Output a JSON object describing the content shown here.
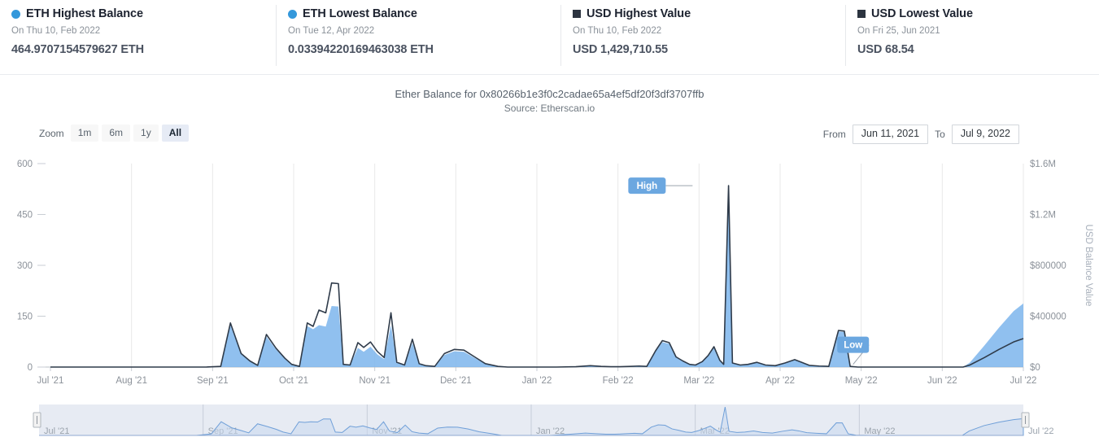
{
  "stats": [
    {
      "marker": "circle-marker-blue",
      "title": "ETH Highest Balance",
      "date": "On Thu 10, Feb 2022",
      "value": "464.9707154579627 ETH"
    },
    {
      "marker": "circle-marker-blue",
      "title": "ETH Lowest Balance",
      "date": "On Tue 12, Apr 2022",
      "value": "0.03394220169463038 ETH"
    },
    {
      "marker": "square-marker-dark",
      "title": "USD Highest Value",
      "date": "On Thu 10, Feb 2022",
      "value": "USD 1,429,710.55"
    },
    {
      "marker": "square-marker-dark",
      "title": "USD Lowest Value",
      "date": "On Fri 25, Jun 2021",
      "value": "USD 68.54"
    }
  ],
  "toolbar": {
    "zoom_label": "Zoom",
    "zoom_options": [
      "1m",
      "6m",
      "1y",
      "All"
    ],
    "zoom_selected": "All",
    "from_label": "From",
    "to_label": "To",
    "from_value": "Jun 11, 2021",
    "to_value": "Jul 9, 2022"
  },
  "colors": {
    "eth_line": "#2f3b4a",
    "usd_area": "#7cb5ec",
    "usd_area_stroke": "#6ba7e0",
    "flag": "#6ba7e0",
    "grid": "#e8e8e8",
    "axis_text": "#8b9199"
  },
  "chart_data": {
    "type": "area",
    "title": "Ether Balance for 0x80266b1e3f0c2cadae65a4ef5df20f3df3707ffb",
    "subtitle": "Source: Etherscan.io",
    "xlabel": "",
    "ylabel": "",
    "y2label": "USD Balance Value",
    "grid": true,
    "legend_position": "none",
    "x_range": [
      "Jun 11, 2021",
      "Jul 9, 2022"
    ],
    "x_ticks": [
      "Jul '21",
      "Aug '21",
      "Sep '21",
      "Oct '21",
      "Nov '21",
      "Dec '21",
      "Jan '22",
      "Feb '22",
      "Mar '22",
      "Apr '22",
      "May '22",
      "Jun '22",
      "Jul '22"
    ],
    "y_ticks": [
      0,
      150,
      300,
      450,
      600
    ],
    "ylim": [
      0,
      600
    ],
    "y2_ticks": [
      "$0",
      "$400000",
      "$800000",
      "$1.2M",
      "$1.6M"
    ],
    "y2_tick_values": [
      0,
      400000,
      800000,
      1200000,
      1600000
    ],
    "y2lim": [
      0,
      1600000
    ],
    "annotations": [
      {
        "label": "High",
        "at_x": 0.66,
        "at_y": 535
      },
      {
        "label": "Low",
        "at_x": 0.825,
        "at_y": 8
      }
    ],
    "series": [
      {
        "name": "ETH Balance",
        "type": "line",
        "axis": "left",
        "color": "#2f3b4a",
        "points": [
          [
            0.0,
            0
          ],
          [
            0.03,
            0
          ],
          [
            0.06,
            0
          ],
          [
            0.09,
            0
          ],
          [
            0.115,
            0
          ],
          [
            0.14,
            0
          ],
          [
            0.16,
            0
          ],
          [
            0.175,
            2
          ],
          [
            0.185,
            130
          ],
          [
            0.196,
            40
          ],
          [
            0.205,
            18
          ],
          [
            0.213,
            5
          ],
          [
            0.222,
            96
          ],
          [
            0.232,
            55
          ],
          [
            0.241,
            26
          ],
          [
            0.248,
            8
          ],
          [
            0.256,
            2
          ],
          [
            0.264,
            130
          ],
          [
            0.27,
            120
          ],
          [
            0.276,
            168
          ],
          [
            0.283,
            160
          ],
          [
            0.289,
            248
          ],
          [
            0.296,
            246
          ],
          [
            0.301,
            8
          ],
          [
            0.308,
            6
          ],
          [
            0.316,
            72
          ],
          [
            0.322,
            58
          ],
          [
            0.329,
            74
          ],
          [
            0.336,
            46
          ],
          [
            0.343,
            28
          ],
          [
            0.35,
            160
          ],
          [
            0.356,
            14
          ],
          [
            0.364,
            6
          ],
          [
            0.372,
            82
          ],
          [
            0.379,
            10
          ],
          [
            0.386,
            4
          ],
          [
            0.395,
            2
          ],
          [
            0.405,
            40
          ],
          [
            0.415,
            52
          ],
          [
            0.425,
            50
          ],
          [
            0.436,
            30
          ],
          [
            0.447,
            10
          ],
          [
            0.46,
            2
          ],
          [
            0.47,
            0
          ],
          [
            0.485,
            0
          ],
          [
            0.5,
            0
          ],
          [
            0.52,
            0
          ],
          [
            0.54,
            1
          ],
          [
            0.555,
            4
          ],
          [
            0.566,
            2
          ],
          [
            0.576,
            1
          ],
          [
            0.585,
            1
          ],
          [
            0.596,
            2
          ],
          [
            0.605,
            3
          ],
          [
            0.613,
            2
          ],
          [
            0.622,
            48
          ],
          [
            0.629,
            78
          ],
          [
            0.636,
            72
          ],
          [
            0.643,
            30
          ],
          [
            0.65,
            18
          ],
          [
            0.657,
            8
          ],
          [
            0.663,
            6
          ],
          [
            0.67,
            16
          ],
          [
            0.676,
            34
          ],
          [
            0.682,
            60
          ],
          [
            0.688,
            20
          ],
          [
            0.692,
            8
          ],
          [
            0.697,
            535
          ],
          [
            0.701,
            12
          ],
          [
            0.709,
            6
          ],
          [
            0.717,
            8
          ],
          [
            0.726,
            14
          ],
          [
            0.735,
            6
          ],
          [
            0.745,
            4
          ],
          [
            0.755,
            12
          ],
          [
            0.765,
            22
          ],
          [
            0.772,
            14
          ],
          [
            0.78,
            5
          ],
          [
            0.79,
            3
          ],
          [
            0.8,
            2
          ],
          [
            0.81,
            108
          ],
          [
            0.816,
            106
          ],
          [
            0.822,
            2
          ],
          [
            0.83,
            0.03
          ],
          [
            0.845,
            0
          ],
          [
            0.865,
            0
          ],
          [
            0.885,
            0
          ],
          [
            0.905,
            0
          ],
          [
            0.925,
            0
          ],
          [
            0.938,
            0
          ],
          [
            0.945,
            6
          ],
          [
            0.96,
            28
          ],
          [
            0.975,
            52
          ],
          [
            0.99,
            74
          ],
          [
            1.0,
            84
          ]
        ]
      },
      {
        "name": "USD Balance Value",
        "type": "area",
        "axis": "right",
        "color": "#7cb5ec",
        "points": [
          [
            0.0,
            0
          ],
          [
            0.03,
            0
          ],
          [
            0.06,
            0
          ],
          [
            0.09,
            0
          ],
          [
            0.115,
            0
          ],
          [
            0.14,
            0
          ],
          [
            0.16,
            0
          ],
          [
            0.175,
            4000
          ],
          [
            0.185,
            330000
          ],
          [
            0.196,
            100000
          ],
          [
            0.205,
            44000
          ],
          [
            0.213,
            12000
          ],
          [
            0.222,
            238000
          ],
          [
            0.232,
            138000
          ],
          [
            0.241,
            66000
          ],
          [
            0.248,
            20000
          ],
          [
            0.256,
            5000
          ],
          [
            0.264,
            322000
          ],
          [
            0.27,
            298000
          ],
          [
            0.276,
            330000
          ],
          [
            0.283,
            318000
          ],
          [
            0.289,
            480000
          ],
          [
            0.296,
            476000
          ],
          [
            0.301,
            20000
          ],
          [
            0.308,
            15000
          ],
          [
            0.316,
            150000
          ],
          [
            0.322,
            120000
          ],
          [
            0.329,
            160000
          ],
          [
            0.336,
            100000
          ],
          [
            0.343,
            62000
          ],
          [
            0.35,
            330000
          ],
          [
            0.356,
            34000
          ],
          [
            0.364,
            14000
          ],
          [
            0.372,
            190000
          ],
          [
            0.379,
            24000
          ],
          [
            0.386,
            10000
          ],
          [
            0.395,
            5000
          ],
          [
            0.405,
            95000
          ],
          [
            0.415,
            124000
          ],
          [
            0.425,
            120000
          ],
          [
            0.436,
            72000
          ],
          [
            0.447,
            24000
          ],
          [
            0.46,
            5000
          ],
          [
            0.47,
            0
          ],
          [
            0.485,
            0
          ],
          [
            0.5,
            0
          ],
          [
            0.52,
            0
          ],
          [
            0.54,
            2500
          ],
          [
            0.555,
            10000
          ],
          [
            0.566,
            5000
          ],
          [
            0.576,
            2500
          ],
          [
            0.585,
            2500
          ],
          [
            0.596,
            5000
          ],
          [
            0.605,
            8000
          ],
          [
            0.613,
            5000
          ],
          [
            0.622,
            122000
          ],
          [
            0.629,
            196000
          ],
          [
            0.636,
            182000
          ],
          [
            0.643,
            76000
          ],
          [
            0.65,
            46000
          ],
          [
            0.657,
            20000
          ],
          [
            0.663,
            15000
          ],
          [
            0.67,
            40000
          ],
          [
            0.676,
            86000
          ],
          [
            0.682,
            152000
          ],
          [
            0.688,
            50000
          ],
          [
            0.692,
            20000
          ],
          [
            0.697,
            1429710
          ],
          [
            0.701,
            30000
          ],
          [
            0.709,
            15000
          ],
          [
            0.717,
            20000
          ],
          [
            0.726,
            36000
          ],
          [
            0.735,
            15000
          ],
          [
            0.745,
            10000
          ],
          [
            0.755,
            30000
          ],
          [
            0.765,
            56000
          ],
          [
            0.772,
            36000
          ],
          [
            0.78,
            13000
          ],
          [
            0.79,
            8000
          ],
          [
            0.8,
            5000
          ],
          [
            0.81,
            280000
          ],
          [
            0.816,
            275000
          ],
          [
            0.822,
            5000
          ],
          [
            0.83,
            69
          ],
          [
            0.845,
            0
          ],
          [
            0.865,
            0
          ],
          [
            0.885,
            0
          ],
          [
            0.905,
            0
          ],
          [
            0.925,
            0
          ],
          [
            0.938,
            0
          ],
          [
            0.945,
            35000
          ],
          [
            0.96,
            170000
          ],
          [
            0.975,
            310000
          ],
          [
            0.99,
            440000
          ],
          [
            1.0,
            500000
          ]
        ]
      }
    ]
  },
  "navigator": {
    "x_ticks": [
      "Jul '21",
      "Sep '21",
      "Nov '21",
      "Jan '22",
      "Mar '22",
      "May '22",
      "Jul '22"
    ],
    "handle_left_name": "navigator-handle-left",
    "handle_right_name": "navigator-handle-right"
  }
}
